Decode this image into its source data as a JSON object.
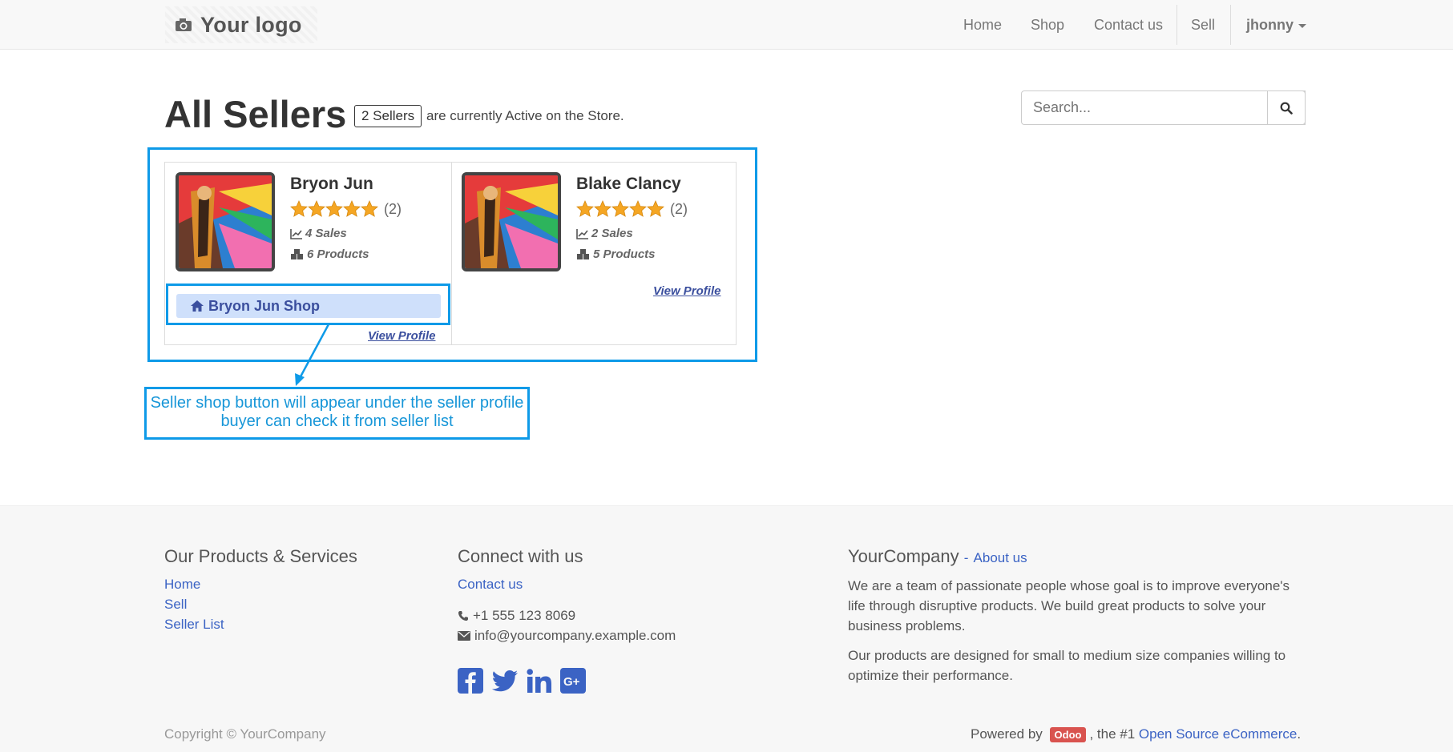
{
  "navbar": {
    "logo_text": "Your logo",
    "items": [
      {
        "label": "Home"
      },
      {
        "label": "Shop"
      },
      {
        "label": "Contact us"
      },
      {
        "label": "Sell"
      }
    ],
    "user": "jhonny"
  },
  "header": {
    "title": "All Sellers",
    "count_badge": "2 Sellers",
    "count_suffix": "are currently Active on the Store."
  },
  "search": {
    "placeholder": "Search..."
  },
  "sellers": [
    {
      "name": "Bryon Jun",
      "rating": 5,
      "rating_count": "(2)",
      "sales": "4 Sales",
      "products": "6 Products",
      "shop_button": "Bryon Jun Shop",
      "view_profile": "View Profile"
    },
    {
      "name": "Blake Clancy",
      "rating": 5,
      "rating_count": "(2)",
      "sales": "2 Sales",
      "products": "5 Products",
      "view_profile": "View Profile"
    }
  ],
  "annotation": {
    "line1": "Seller shop button will appear under the seller profile",
    "line2": "buyer can check it from seller list"
  },
  "footer": {
    "col1": {
      "title": "Our Products & Services",
      "links": [
        "Home",
        "Sell",
        "Seller List"
      ]
    },
    "col2": {
      "title": "Connect with us",
      "contact_link": "Contact us",
      "phone": "+1 555 123 8069",
      "email": "info@yourcompany.example.com",
      "social": [
        "facebook-icon",
        "twitter-icon",
        "linkedin-icon",
        "google-plus-icon"
      ]
    },
    "col3": {
      "title": "YourCompany",
      "about_link": "About us",
      "about_sep": "-",
      "para1": "We are a team of passionate people whose goal is to improve everyone's life through disruptive products. We build great products to solve your business problems.",
      "para2": "Our products are designed for small to medium size companies willing to optimize their performance."
    },
    "copyright": "Copyright © YourCompany",
    "powered_prefix": "Powered by",
    "powered_badge": "Odoo",
    "powered_mid": ", the #1",
    "powered_link": "Open Source eCommerce",
    "powered_end": "."
  },
  "colors": {
    "annotation": "#0E9AE8",
    "link": "#3B63C4",
    "star": "#F5A623",
    "shop_button_bg": "#cfe0fb"
  }
}
